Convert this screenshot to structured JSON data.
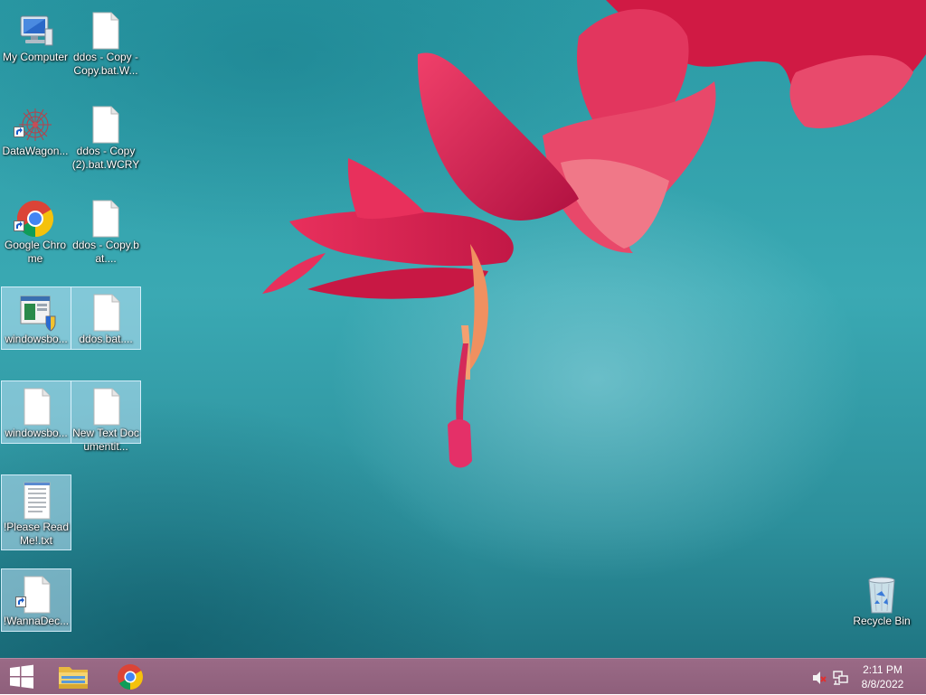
{
  "desktop": {
    "icons": [
      {
        "label": "My Computer",
        "icon": "computer-icon"
      },
      {
        "label": "ddos - Copy - Copy.bat.W...",
        "icon": "blank-file-icon"
      },
      {
        "label": "DataWagon...",
        "icon": "datawagon-icon"
      },
      {
        "label": "ddos - Copy (2).bat.WCRY",
        "icon": "blank-file-icon"
      },
      {
        "label": "Google Chrome",
        "icon": "chrome-icon"
      },
      {
        "label": "ddos - Copy.bat....",
        "icon": "blank-file-icon"
      },
      {
        "label": "windowsbo...",
        "icon": "installer-icon"
      },
      {
        "label": "ddos.bat....",
        "icon": "blank-file-icon"
      },
      {
        "label": "windowsbo...",
        "icon": "blank-file-icon"
      },
      {
        "label": "New Text Documentit...",
        "icon": "blank-file-icon"
      },
      {
        "label": "!Please Read Me!.txt",
        "icon": "text-file-icon"
      },
      {
        "label": "!WannaDec...",
        "icon": "blank-file-icon"
      }
    ],
    "recycle_bin": {
      "label": "Recycle Bin",
      "icon": "recycle-bin-icon"
    }
  },
  "taskbar": {
    "start": {
      "icon": "windows-start-icon"
    },
    "pinned": [
      {
        "name": "File Explorer",
        "icon": "file-explorer-icon"
      },
      {
        "name": "Google Chrome",
        "icon": "chrome-icon"
      }
    ],
    "tray": {
      "volume_icon": "volume-muted-icon",
      "network_icon": "network-icon",
      "time": "2:11 PM",
      "date": "8/8/2022"
    }
  },
  "colors": {
    "taskbar": "#8e5f7b",
    "desktop_teal": "#3aa9b3",
    "flower_red": "#d81e4a",
    "selection": "#bee1f5"
  }
}
